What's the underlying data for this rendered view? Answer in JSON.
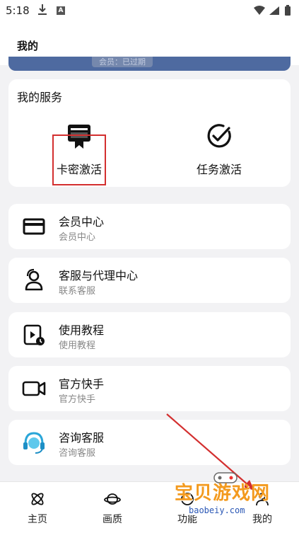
{
  "status_bar": {
    "time": "5:18"
  },
  "header": {
    "title": "我的"
  },
  "banner": {
    "text": "会员：已过期"
  },
  "services": {
    "title": "我的服务",
    "items": [
      {
        "label": "卡密激活",
        "icon": "card-key-icon"
      },
      {
        "label": "任务激活",
        "icon": "check-circle-icon"
      }
    ]
  },
  "menu": [
    {
      "title": "会员中心",
      "subtitle": "会员中心",
      "icon": "credit-card-icon"
    },
    {
      "title": "客服与代理中心",
      "subtitle": "联系客服",
      "icon": "person-icon"
    },
    {
      "title": "使用教程",
      "subtitle": "使用教程",
      "icon": "video-clock-icon"
    },
    {
      "title": "官方快手",
      "subtitle": "官方快手",
      "icon": "video-camera-icon"
    },
    {
      "title": "咨询客服",
      "subtitle": "咨询客服",
      "icon": "headset-icon"
    }
  ],
  "bottom_nav": [
    {
      "label": "主页",
      "icon": "atom-icon"
    },
    {
      "label": "画质",
      "icon": "planet-icon"
    },
    {
      "label": "功能",
      "icon": "function-icon"
    },
    {
      "label": "我的",
      "icon": "profile-icon"
    }
  ],
  "watermark": {
    "text": "宝贝游戏网",
    "url": "baobeiy.com"
  },
  "colors": {
    "highlight": "#d32f2f",
    "banner": "#4e6aa0",
    "arrow": "#d32f2f"
  }
}
